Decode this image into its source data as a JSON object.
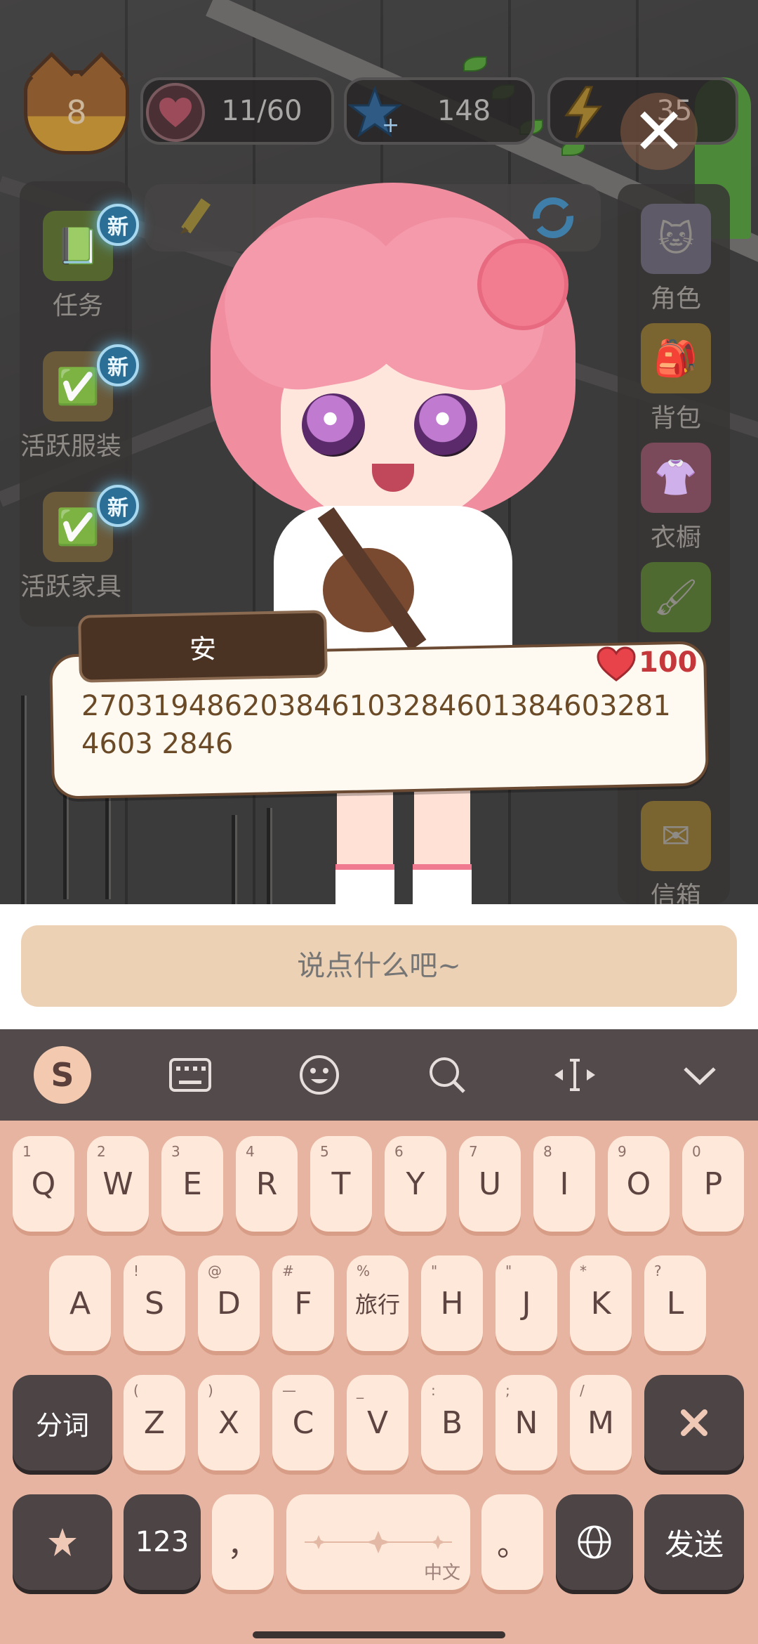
{
  "hud": {
    "level": "8",
    "hearts": "11/60",
    "stars": "148",
    "energy": "35"
  },
  "left_menu": [
    {
      "label": "任务",
      "badge": "新"
    },
    {
      "label": "活跃服装",
      "badge": "新"
    },
    {
      "label": "活跃家具",
      "badge": "新"
    }
  ],
  "right_menu": [
    {
      "label": "角色"
    },
    {
      "label": "背包"
    },
    {
      "label": "衣橱"
    },
    {
      "label": "信箱"
    }
  ],
  "dialog": {
    "name": "安",
    "text": "2703194862038461032846013846032814603 2846",
    "hearts": "100"
  },
  "input": {
    "placeholder": "说点什么吧~"
  },
  "keyboard": {
    "row1": [
      {
        "label": "Q",
        "sub": "1"
      },
      {
        "label": "W",
        "sub": "2"
      },
      {
        "label": "E",
        "sub": "3"
      },
      {
        "label": "R",
        "sub": "4"
      },
      {
        "label": "T",
        "sub": "5"
      },
      {
        "label": "Y",
        "sub": "6"
      },
      {
        "label": "U",
        "sub": "7"
      },
      {
        "label": "I",
        "sub": "8"
      },
      {
        "label": "O",
        "sub": "9"
      },
      {
        "label": "P",
        "sub": "0"
      }
    ],
    "row2": [
      {
        "label": "A",
        "sub": ""
      },
      {
        "label": "S",
        "sub": "!"
      },
      {
        "label": "D",
        "sub": "@"
      },
      {
        "label": "F",
        "sub": "#"
      },
      {
        "label": "旅行",
        "sub": "%"
      },
      {
        "label": "H",
        "sub": "\""
      },
      {
        "label": "J",
        "sub": "\""
      },
      {
        "label": "K",
        "sub": "*"
      },
      {
        "label": "L",
        "sub": "?"
      }
    ],
    "row3": [
      {
        "label": "Z",
        "sub": "("
      },
      {
        "label": "X",
        "sub": ")"
      },
      {
        "label": "C",
        "sub": "—"
      },
      {
        "label": "V",
        "sub": "_"
      },
      {
        "label": "B",
        "sub": ":"
      },
      {
        "label": "N",
        "sub": ";"
      },
      {
        "label": "M",
        "sub": "/"
      }
    ],
    "fenci": "分词",
    "num": "123",
    "comma": "，",
    "space_lang": "中文",
    "period": "。",
    "send": "发送"
  },
  "colors": {
    "dialog_text": "#6b4a28",
    "key_bg": "#fde8d9",
    "keyboard_bg": "#e6b4a0",
    "dark_key": "#4d4446"
  }
}
